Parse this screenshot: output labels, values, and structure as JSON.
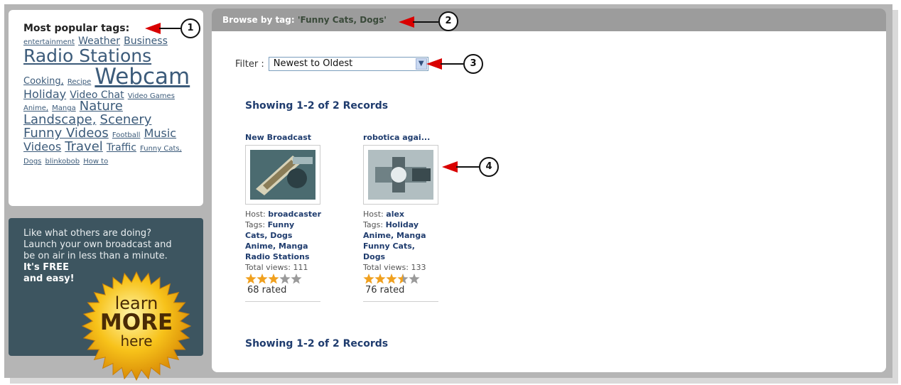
{
  "sidebar": {
    "tags_title": "Most popular tags:",
    "tags": [
      {
        "label": "entertainment",
        "size": 1
      },
      {
        "label": "Weather",
        "size": 3
      },
      {
        "label": "Business",
        "size": 3
      },
      {
        "label": "Radio Stations",
        "size": 6
      },
      {
        "label": "Cooking,",
        "size": 2
      },
      {
        "label": "Recipe",
        "size": 1
      },
      {
        "label": "Webcam",
        "size": 7
      },
      {
        "label": "Holiday",
        "size": 4
      },
      {
        "label": "Video Chat",
        "size": 3
      },
      {
        "label": "Video Games",
        "size": 1
      },
      {
        "label": "Anime,",
        "size": 1
      },
      {
        "label": "Manga",
        "size": 1
      },
      {
        "label": "Nature",
        "size": 5
      },
      {
        "label": "Landscape,",
        "size": 5
      },
      {
        "label": "Scenery",
        "size": 5
      },
      {
        "label": "Funny Videos",
        "size": 5
      },
      {
        "label": "Football",
        "size": 1
      },
      {
        "label": "Music Videos",
        "size": 4
      },
      {
        "label": "Travel",
        "size": 5
      },
      {
        "label": "Traffic",
        "size": 3
      },
      {
        "label": "Funny Cats, Dogs",
        "size": 1
      },
      {
        "label": "blinkobob",
        "size": 1
      },
      {
        "label": "How to",
        "size": 1
      }
    ]
  },
  "promo": {
    "line1": "Like what others are doing?",
    "line2": "Launch your own broadcast and",
    "line3": "be on air in less than a minute.",
    "bold1": "It's FREE",
    "bold2": "and easy!",
    "badge_learn": "learn",
    "badge_more": "MORE",
    "badge_here": "here"
  },
  "main": {
    "header_prefix": "Browse by tag:",
    "header_tag": "'Funny Cats, Dogs'",
    "filter_label": "Filter :",
    "filter_value": "Newest to Oldest",
    "showing": "Showing 1-2 of 2 Records",
    "cards": [
      {
        "title": "New Broadcast",
        "host_label": "Host:",
        "host": "broadcaster",
        "tags_label": "Tags:",
        "tags_lines": [
          "Funny",
          "Cats, Dogs",
          "Anime, Manga",
          "Radio Stations"
        ],
        "views": "Total views: 111",
        "rating": 3,
        "rated": "68 rated"
      },
      {
        "title": "robotica agai...",
        "host_label": "Host:",
        "host": "alex",
        "tags_label": "Tags:",
        "tags_lines": [
          "Holiday",
          "Anime, Manga",
          "Funny Cats,",
          "Dogs"
        ],
        "views": "Total views: 133",
        "rating": 3.5,
        "rated": "76 rated"
      }
    ]
  },
  "callouts": [
    "1",
    "2",
    "3",
    "4"
  ],
  "colors": {
    "arrow": "#d90000",
    "accent": "#1f3c6e",
    "promo_bg": "#3d5560",
    "header_bg": "#9c9c9c"
  }
}
